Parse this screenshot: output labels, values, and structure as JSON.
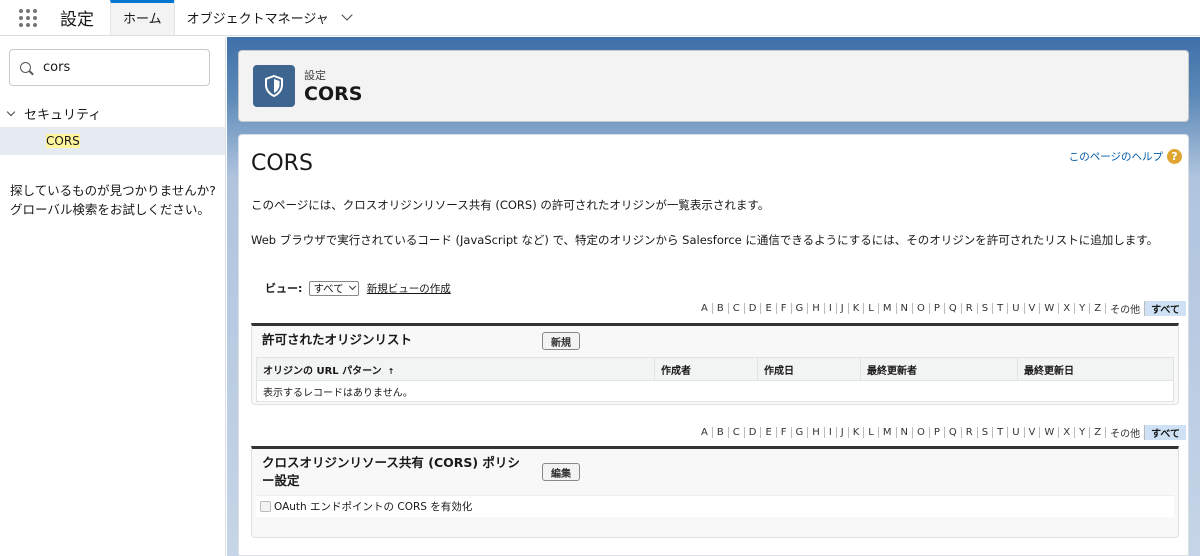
{
  "app": {
    "name": "設定"
  },
  "nav": {
    "tabs": [
      {
        "label": "ホーム"
      },
      {
        "label": "オブジェクトマネージャ"
      }
    ]
  },
  "sidebar": {
    "search_value": "cors",
    "section_label": "セキュリティ",
    "item_label": "CORS",
    "not_found_line1": "探しているものが見つかりませんか?",
    "not_found_line2": "グローバル検索をお試しください。"
  },
  "header": {
    "subtitle": "設定",
    "title": "CORS"
  },
  "page": {
    "title": "CORS",
    "help_link": "このページのヘルプ",
    "help_icon": "question-icon",
    "desc1": "このページには、クロスオリジンリソース共有 (CORS) の許可されたオリジンが一覧表示されます。",
    "desc2": "Web ブラウザで実行されているコード (JavaScript など) で、特定のオリジンから Salesforce に通信できるようにするには、そのオリジンを許可されたリストに追加します。"
  },
  "view": {
    "label": "ビュー:",
    "selected": "すべて",
    "create_link": "新規ビューの作成"
  },
  "alphabet": [
    "A",
    "B",
    "C",
    "D",
    "E",
    "F",
    "G",
    "H",
    "I",
    "J",
    "K",
    "L",
    "M",
    "N",
    "O",
    "P",
    "Q",
    "R",
    "S",
    "T",
    "U",
    "V",
    "W",
    "X",
    "Y",
    "Z",
    "その他",
    "すべて"
  ],
  "origin_list": {
    "title": "許可されたオリジンリスト",
    "new_button": "新規",
    "columns": [
      "オリジンの URL パターン",
      "作成者",
      "作成日",
      "最終更新者",
      "最終更新日"
    ],
    "sort_indicator": "↑",
    "empty_message": "表示するレコードはありません。"
  },
  "policy": {
    "title_line1": "クロスオリジンリソース共有 (CORS) ポリシ",
    "title_line2": "ー設定",
    "edit_button": "編集",
    "checkbox_label": "OAuth エンドポイントの CORS を有効化",
    "checkbox_checked": false
  },
  "colors": {
    "accent": "#0176d3",
    "header_icon": "#3e6590",
    "help_icon": "#e0a531",
    "link": "#015ba7"
  }
}
